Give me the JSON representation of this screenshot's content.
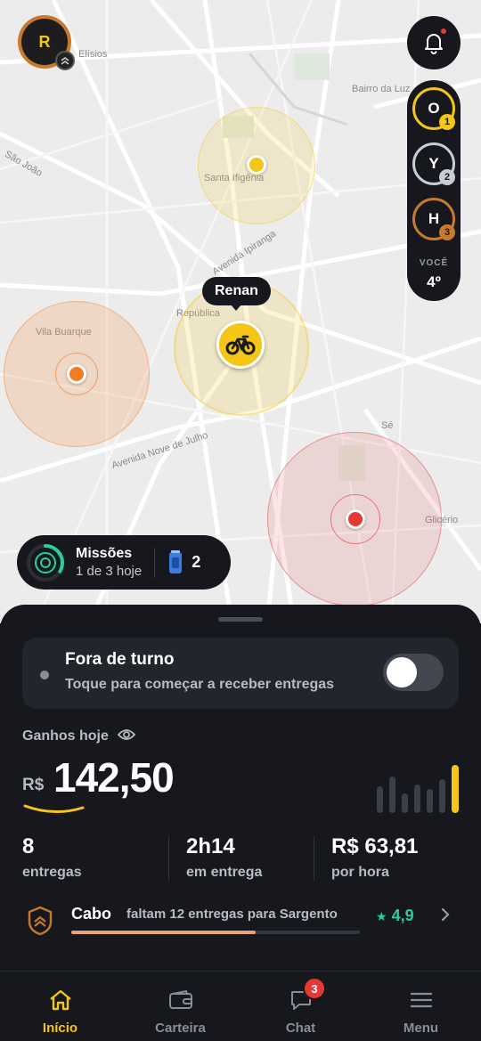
{
  "profile": {
    "initial": "R"
  },
  "map": {
    "labels": [
      "Elísios",
      "Bairro da Luz",
      "São João",
      "Santa Ifigênia",
      "Avenida Ipiranga",
      "República",
      "Vila Buarque",
      "Avenida Nove de Julho",
      "Sé",
      "Glicério"
    ],
    "user_name": "Renan"
  },
  "ranking": {
    "entries": [
      {
        "initial": "O",
        "position": "1",
        "color": "#f5c518"
      },
      {
        "initial": "Y",
        "position": "2",
        "color": "#c9ccd3"
      },
      {
        "initial": "H",
        "position": "3",
        "color": "#c77a2d"
      }
    ],
    "you_label": "VOCÊ",
    "you_position": "4º"
  },
  "missions": {
    "title": "Missões",
    "subtitle": "1 de 3 hoje",
    "count": "2"
  },
  "shift": {
    "title": "Fora de turno",
    "subtitle": "Toque para começar a receber entregas",
    "enabled": false
  },
  "earnings": {
    "label": "Ganhos hoje",
    "currency": "R$",
    "value": "142,50",
    "bar_levels": [
      0.55,
      0.75,
      0.4,
      0.6,
      0.5,
      0.7,
      1.0
    ]
  },
  "stats": [
    {
      "value": "8",
      "label": "entregas"
    },
    {
      "value": "2h14",
      "label": "em entrega"
    },
    {
      "value": "R$ 63,81",
      "label": "por hora"
    }
  ],
  "rank_progress": {
    "rank": "Cabo",
    "message": "faltam 12 entregas para Sargento",
    "progress": 0.64,
    "rating": "4,9"
  },
  "nav": {
    "items": [
      {
        "label": "Início",
        "active": true
      },
      {
        "label": "Carteira",
        "active": false
      },
      {
        "label": "Chat",
        "active": false,
        "badge": "3"
      },
      {
        "label": "Menu",
        "active": false
      }
    ]
  },
  "colors": {
    "accent": "#f5c518",
    "success": "#2ecc9a",
    "danger": "#e53935"
  }
}
